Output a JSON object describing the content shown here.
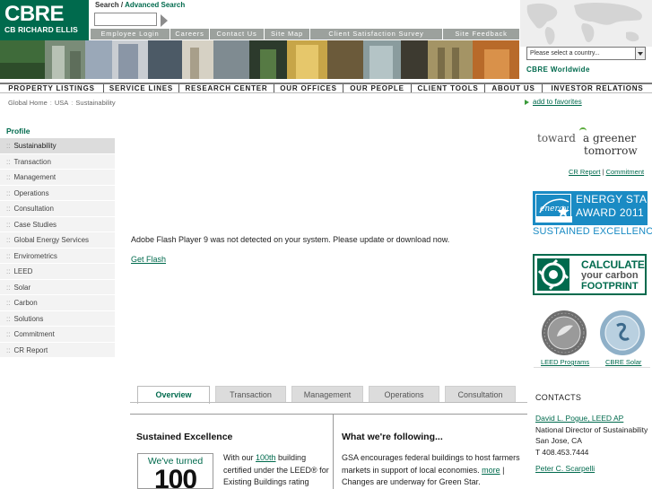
{
  "logo": {
    "main": "CBRE",
    "sub": "CB RICHARD ELLIS"
  },
  "search": {
    "label": "Search",
    "sep": " / ",
    "advanced": "Advanced Search",
    "value": ""
  },
  "util_links": [
    "Employee Login",
    "Careers",
    "Contact Us",
    "Site Map",
    "Client Satisfaction Survey",
    "Site Feedback"
  ],
  "country_select": {
    "selected": "Please select a country..."
  },
  "worldwide": "CBRE Worldwide",
  "main_nav": [
    "PROPERTY LISTINGS",
    "SERVICE LINES",
    "RESEARCH CENTER",
    "OUR OFFICES",
    "OUR PEOPLE",
    "CLIENT TOOLS",
    "ABOUT US",
    "INVESTOR RELATIONS"
  ],
  "breadcrumb": [
    "Global Home",
    "USA",
    "Sustainability"
  ],
  "favorites": "add to favorites",
  "sidebar": {
    "title": "Profile",
    "bullet": "::",
    "items": [
      "Sustainability",
      "Transaction",
      "Management",
      "Operations",
      "Consultation",
      "Case Studies",
      "Global Energy Services",
      "Envirometrics",
      "LEED",
      "Solar",
      "Carbon",
      "Solutions",
      "Commitment",
      "CR Report"
    ],
    "active_index": 0
  },
  "flash": {
    "message": "Adobe Flash Player 9 was not detected on your system. Please update or download now.",
    "link": "Get Flash"
  },
  "tabs": {
    "items": [
      "Overview",
      "Transaction",
      "Management",
      "Operations",
      "Consultation"
    ],
    "active_index": 0
  },
  "sustained": {
    "heading": "Sustained Excellence",
    "badge_line1": "We've turned",
    "badge_line2": "100",
    "p_before": "With our ",
    "p_link": "100th",
    "p_after": " building certified under the LEED® for Existing Buildings rating"
  },
  "following": {
    "heading": "What we're following...",
    "p_text": "GSA encourages federal buildings to host farmers markets in support of local economies. ",
    "p_link": "more",
    "p_after": " | Changes are underway for Green Star."
  },
  "greener": {
    "toward": "toward",
    "line1": "a greener",
    "line2": "tomorrow"
  },
  "cr_links": {
    "report": "CR Report",
    "sep": " | ",
    "commitment": "Commitment"
  },
  "energy_star": {
    "line1": "ENERGY STAR",
    "line2": "AWARD 2011",
    "line3": "SUSTAINED EXCELLENCE",
    "logo_text": "energy",
    "color": "#1a8bc4"
  },
  "carbon": {
    "line1": "CALCULATE",
    "line2": "your carbon",
    "line3": "FOOTPRINT"
  },
  "badges": {
    "leed_link": "LEED Programs",
    "solar_link": "CBRE Solar"
  },
  "contacts": {
    "heading": "CONTACTS",
    "people": [
      {
        "name": "David L. Pogue, LEED AP",
        "title": "National Director of Sustainability",
        "city": "San Jose, CA",
        "phone": "T 408.453.7444"
      },
      {
        "name": "Peter C. Scarpelli"
      }
    ]
  },
  "colors": {
    "brand": "#006a4d",
    "nav_gray": "#9ca19d"
  }
}
